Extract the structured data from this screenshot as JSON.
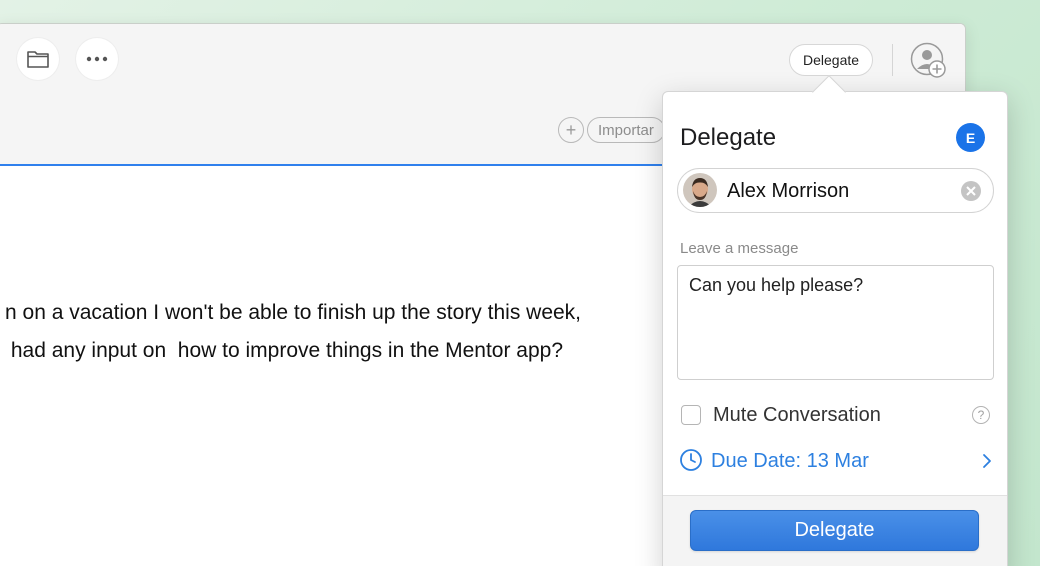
{
  "toolbar": {
    "delegate_label": "Delegate",
    "tag_label": "Importar",
    "add_tag_glyph": "+"
  },
  "email": {
    "body_lines": [
      "n on a vacation I won't be able to finish up the story this week,",
      " had any input on  how to improve things in the Mentor app?"
    ]
  },
  "popover": {
    "title": "Delegate",
    "user_badge": "E",
    "assignee": "Alex Morrison",
    "message_label": "Leave a message",
    "message_value": "Can you help please?",
    "mute_label": "Mute Conversation",
    "mute_checked": false,
    "due_label": "Due Date: 13 Mar",
    "button_label": "Delegate"
  },
  "colors": {
    "accent": "#2d80e0",
    "badge": "#1a73e8",
    "button": "#2f78dc",
    "background": "#cdebd5"
  },
  "icons": [
    "folder-icon",
    "more-icon",
    "add-user-icon",
    "add-tag-icon",
    "clear-icon",
    "help-icon",
    "clock-icon",
    "chevron-right-icon"
  ]
}
